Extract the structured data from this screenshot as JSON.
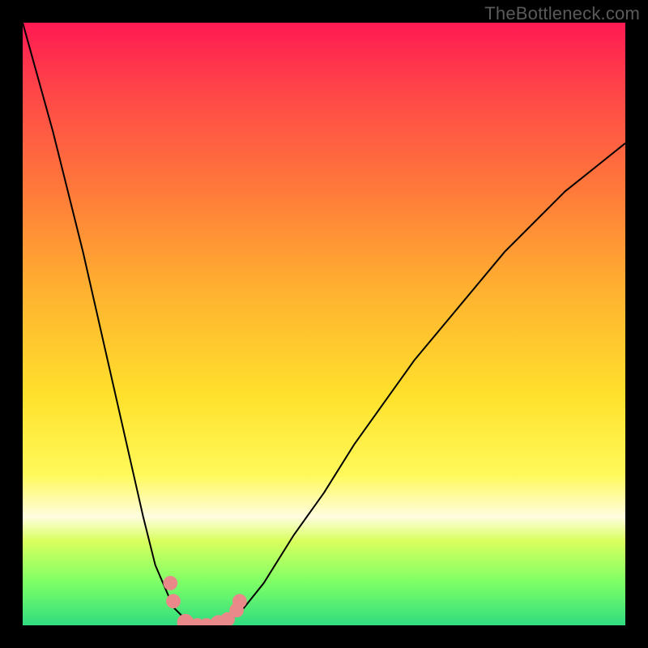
{
  "watermark": "TheBottleneck.com",
  "chart_data": {
    "type": "line",
    "title": "",
    "xlabel": "",
    "ylabel": "",
    "xlim": [
      0,
      100
    ],
    "ylim": [
      0,
      100
    ],
    "grid": false,
    "legend": false,
    "description": "Bottleneck curve with minimum near x≈30; y is bottleneck percentage (0 at compatibility, 100 at worst). Background gradient encodes severity (green=low near bottom to red=high near top).",
    "series": [
      {
        "name": "bottleneck-curve",
        "x": [
          0,
          5,
          10,
          15,
          20,
          22,
          25,
          28,
          30,
          33,
          36,
          40,
          45,
          50,
          55,
          60,
          65,
          70,
          75,
          80,
          85,
          90,
          95,
          100
        ],
        "y": [
          100,
          82,
          62,
          40,
          18,
          10,
          3,
          0,
          0,
          0,
          2,
          7,
          15,
          22,
          30,
          37,
          44,
          50,
          56,
          62,
          67,
          72,
          76,
          80
        ]
      }
    ],
    "markers": [
      {
        "x": 24.5,
        "y": 7,
        "r": 1.2
      },
      {
        "x": 25,
        "y": 4,
        "r": 1.2
      },
      {
        "x": 27,
        "y": 0.5,
        "r": 1.4
      },
      {
        "x": 29,
        "y": 0,
        "r": 1.2
      },
      {
        "x": 30.5,
        "y": 0,
        "r": 1.2
      },
      {
        "x": 32.5,
        "y": 0.3,
        "r": 1.4
      },
      {
        "x": 34,
        "y": 1,
        "r": 1.2
      },
      {
        "x": 35.5,
        "y": 2.5,
        "r": 1.2
      },
      {
        "x": 36,
        "y": 4,
        "r": 1.2
      }
    ],
    "gradient_stops": [
      {
        "pct": 0,
        "color": "#ff1a52"
      },
      {
        "pct": 12,
        "color": "#ff4848"
      },
      {
        "pct": 28,
        "color": "#ff7a3a"
      },
      {
        "pct": 44,
        "color": "#ffb030"
      },
      {
        "pct": 62,
        "color": "#ffe12c"
      },
      {
        "pct": 75,
        "color": "#fff95a"
      },
      {
        "pct": 82,
        "color": "#fffde0"
      },
      {
        "pct": 86,
        "color": "#d9ff5e"
      },
      {
        "pct": 93,
        "color": "#7cff66"
      },
      {
        "pct": 100,
        "color": "#31dc80"
      }
    ]
  }
}
